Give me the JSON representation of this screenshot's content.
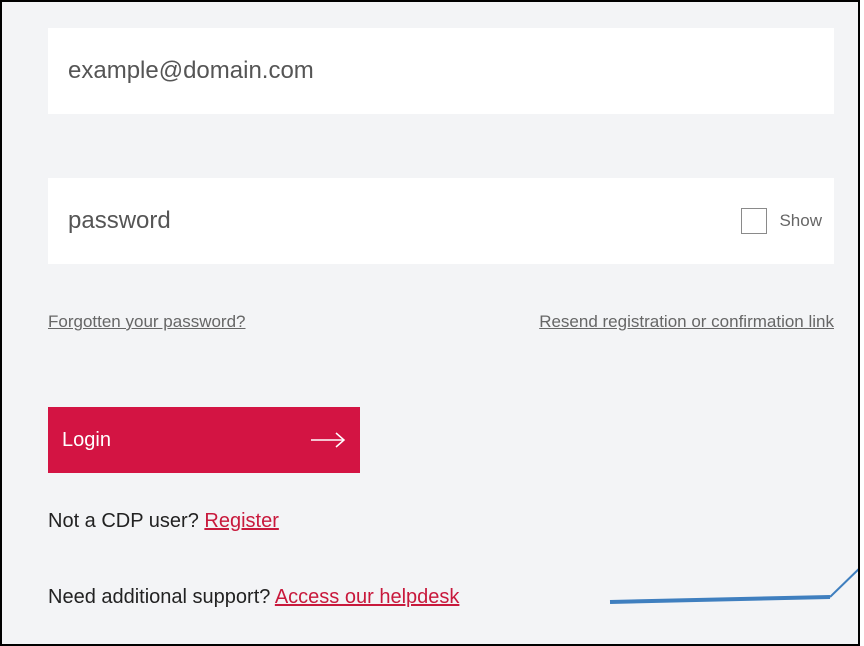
{
  "login_form": {
    "email_placeholder": "example@domain.com",
    "password_placeholder": "password",
    "show_label": "Show",
    "forgot_password_link": "Forgotten your password?",
    "resend_link": "Resend registration or confirmation link",
    "login_button_label": "Login",
    "register_prompt": "Not a CDP user?",
    "register_link": "Register",
    "support_prompt": "Need additional support?",
    "helpdesk_link": "Access our helpdesk"
  },
  "colors": {
    "accent": "#d31443",
    "link_red": "#c8193c",
    "background": "#f3f4f6",
    "annotation": "#3f7fbf"
  },
  "icons": {
    "login_arrow": "arrow-right-icon"
  }
}
